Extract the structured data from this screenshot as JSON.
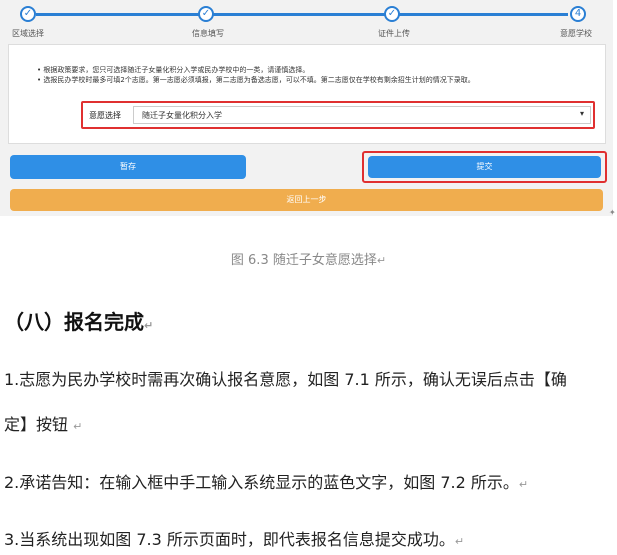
{
  "steps": [
    {
      "label": "区域选择",
      "state": "done"
    },
    {
      "label": "信息填写",
      "state": "done"
    },
    {
      "label": "证件上传",
      "state": "done"
    },
    {
      "label": "意愿学校",
      "state": "current",
      "number": "4"
    }
  ],
  "notice": {
    "line1": "• 根据政策要求，您只可选择随迁子女量化积分入学或民办学校中的一类，请谨慎选择。",
    "line2": "• 选报民办学校时最多可填2个志愿。第一志愿必须填报，第二志愿为备选志愿，可以不填。第二志愿仅在学校有剩余招生计划的情况下录取。"
  },
  "select": {
    "label": "意愿选择",
    "value": "随迁子女量化积分入学"
  },
  "buttons": {
    "save": "暂存",
    "submit": "提交",
    "back": "返回上一步"
  },
  "caption": "图 6.3 随迁子女意愿选择",
  "heading": "（八）报名完成",
  "paragraphs": {
    "p1a": "1.志愿为民办学校时需再次确认报名意愿，如图 7.1 所示，确认无误后点击【确",
    "p1b": "定】按钮",
    "p2": "2.承诺告知：在输入框中手工输入系统显示的蓝色文字，如图 7.2 所示。",
    "p3": "3.当系统出现如图 7.3 所示页面时，即代表报名信息提交成功。"
  },
  "paragraph_mark": "↵",
  "colors": {
    "accent": "#2a7fd4",
    "button_blue": "#2f8fe6",
    "button_orange": "#f0ad4e",
    "highlight_red": "#e03030"
  }
}
